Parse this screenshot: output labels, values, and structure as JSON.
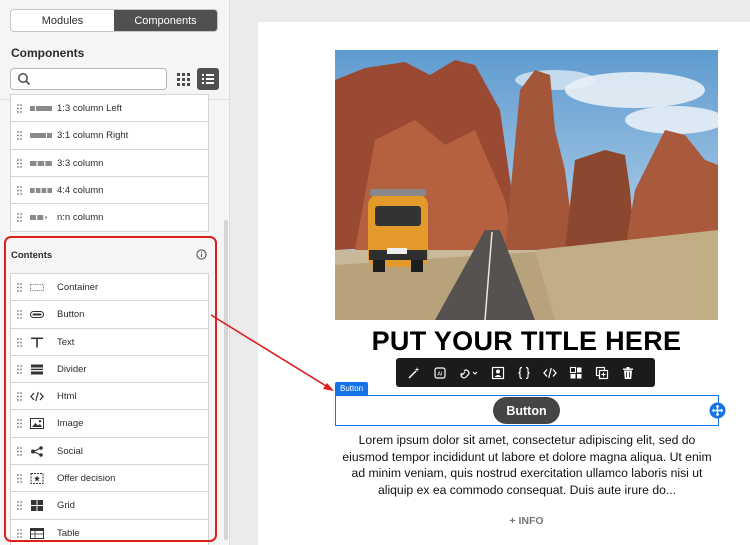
{
  "tabs": [
    {
      "label": "Modules",
      "active": false
    },
    {
      "label": "Components",
      "active": true
    }
  ],
  "panel": {
    "title": "Components",
    "search_placeholder": "",
    "structures": [
      {
        "label": "1:3 column Left",
        "icon": "column-1-3-left-icon"
      },
      {
        "label": "3:1 column Right",
        "icon": "column-3-1-right-icon"
      },
      {
        "label": "3:3 column",
        "icon": "column-3-3-icon"
      },
      {
        "label": "4:4 column",
        "icon": "column-4-4-icon"
      },
      {
        "label": "n:n column",
        "icon": "column-n-n-icon"
      }
    ],
    "contents_title": "Contents",
    "contents": [
      {
        "label": "Container",
        "icon": "container-icon"
      },
      {
        "label": "Button",
        "icon": "button-icon"
      },
      {
        "label": "Text",
        "icon": "text-icon"
      },
      {
        "label": "Divider",
        "icon": "divider-icon"
      },
      {
        "label": "Html",
        "icon": "html-icon"
      },
      {
        "label": "Image",
        "icon": "image-icon"
      },
      {
        "label": "Social",
        "icon": "social-icon"
      },
      {
        "label": "Offer decision",
        "icon": "offer-decision-icon"
      },
      {
        "label": "Grid",
        "icon": "grid-icon"
      },
      {
        "label": "Table",
        "icon": "table-icon"
      }
    ]
  },
  "canvas": {
    "title": "PUT YOUR TITLE HERE",
    "component_tag": "Button",
    "button_label": "Button",
    "body_text": "Lorem ipsum dolor sit amet, consectetur adipiscing elit, sed do eiusmod tempor incididunt ut labore et dolore magna aliqua. Ut enim ad minim veniam, quis nostrud exercitation ullamco laboris nisi ut aliquip ex ea commodo consequat. Duis aute irure do...",
    "more_link": "+ INFO",
    "toolbar": [
      "magic-wand-icon",
      "ai-icon",
      "link-icon",
      "personalize-icon",
      "braces-icon",
      "code-icon",
      "layout-icon",
      "duplicate-icon",
      "delete-icon"
    ]
  },
  "colors": {
    "accent": "#1473e6",
    "highlight": "#e01e1e",
    "segment_active": "#505050",
    "button": "#454545"
  }
}
